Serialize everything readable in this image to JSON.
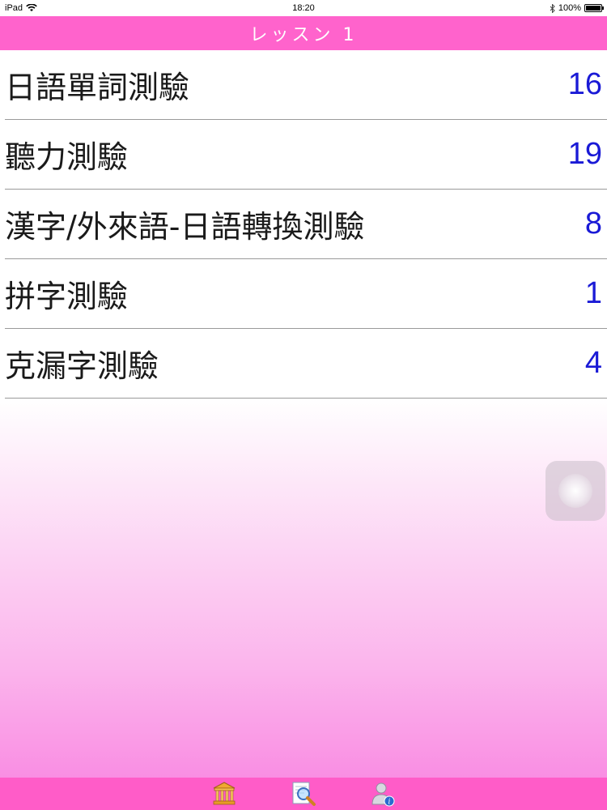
{
  "status_bar": {
    "device": "iPad",
    "time": "18:20",
    "battery": "100%"
  },
  "nav": {
    "title": "レッスン 1"
  },
  "quiz_list": [
    {
      "label": "日語單詞測驗",
      "count": "16"
    },
    {
      "label": "聽力測驗",
      "count": "19"
    },
    {
      "label": "漢字/外來語-日語轉換測驗",
      "count": "8"
    },
    {
      "label": "拼字測驗",
      "count": "1"
    },
    {
      "label": "克漏字測驗",
      "count": "4"
    }
  ],
  "tab_bar": {
    "items": [
      {
        "icon": "library-icon"
      },
      {
        "icon": "search-document-icon"
      },
      {
        "icon": "user-info-icon"
      }
    ]
  },
  "colors": {
    "nav_background": "#ff63cc",
    "tab_background": "#ff5cc8",
    "count_text": "#1a1ad6"
  }
}
